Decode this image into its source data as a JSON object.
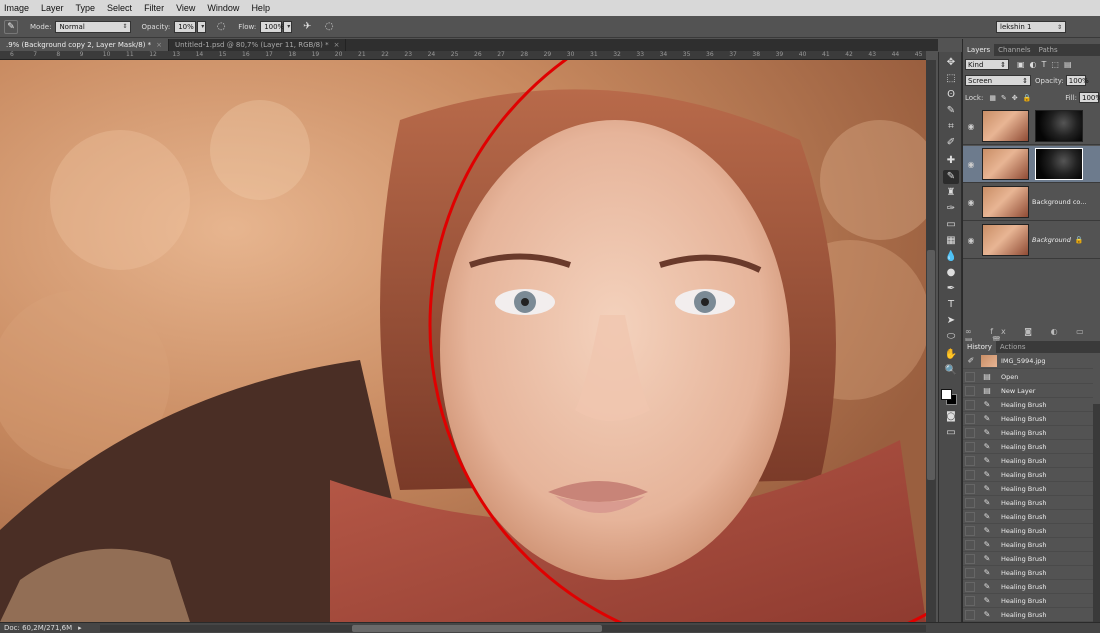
{
  "menu": [
    "Image",
    "Layer",
    "Type",
    "Select",
    "Filter",
    "View",
    "Window",
    "Help"
  ],
  "options": {
    "mode_label": "Mode:",
    "mode_value": "Normal",
    "opacity_label": "Opacity:",
    "opacity_value": "10%",
    "flow_label": "Flow:",
    "flow_value": "100%",
    "workspace": "lekshin 1"
  },
  "tabs": [
    {
      "label": ".9% (Background copy 2, Layer Mask/8) *",
      "active": true
    },
    {
      "label": "Untitled-1.psd @ 80,7% (Layer 11, RGB/8) *",
      "active": false
    }
  ],
  "ruler_ticks": [
    "6",
    "7",
    "8",
    "9",
    "10",
    "11",
    "12",
    "13",
    "14",
    "15",
    "16",
    "17",
    "18",
    "19",
    "20",
    "21",
    "22",
    "23",
    "24",
    "25",
    "26",
    "27",
    "28",
    "29",
    "30",
    "31",
    "32",
    "33",
    "34",
    "35",
    "36",
    "37",
    "38",
    "39",
    "40",
    "41",
    "42",
    "43",
    "44",
    "45"
  ],
  "status": {
    "doc": "Doc: 60,2M/271,6M"
  },
  "layers_panel": {
    "tabs": [
      "Layers",
      "Channels",
      "Paths"
    ],
    "kind": "Kind",
    "blend_mode": "Screen",
    "opacity_label": "Opacity:",
    "opacity_value": "100%",
    "lock_label": "Lock:",
    "fill_label": "Fill:",
    "fill_value": "100%",
    "layers": [
      {
        "name": "",
        "has_mask": true,
        "selected": false
      },
      {
        "name": "",
        "has_mask": true,
        "selected": true
      },
      {
        "name": "Background co...",
        "has_mask": false,
        "selected": false
      },
      {
        "name": "Background",
        "has_mask": false,
        "selected": false
      }
    ]
  },
  "history_panel": {
    "tabs": [
      "History",
      "Actions"
    ],
    "snapshot": "IMG_5994.jpg",
    "items": [
      "Open",
      "New Layer",
      "Healing Brush",
      "Healing Brush",
      "Healing Brush",
      "Healing Brush",
      "Healing Brush",
      "Healing Brush",
      "Healing Brush",
      "Healing Brush",
      "Healing Brush",
      "Healing Brush",
      "Healing Brush",
      "Healing Brush",
      "Healing Brush",
      "Healing Brush",
      "Healing Brush",
      "Healing Brush"
    ]
  },
  "colors": {
    "annotation_circle": "#e00000",
    "ui_dark": "#535353",
    "selected_layer": "#6d7b8d"
  },
  "tool_icons": [
    "move-tool-icon",
    "marquee-tool-icon",
    "lasso-tool-icon",
    "quick-selection-tool-icon",
    "crop-tool-icon",
    "eyedropper-tool-icon",
    "spot-healing-tool-icon",
    "brush-tool-icon",
    "clone-stamp-tool-icon",
    "history-brush-tool-icon",
    "eraser-tool-icon",
    "gradient-tool-icon",
    "blur-tool-icon",
    "dodge-tool-icon",
    "pen-tool-icon",
    "type-tool-icon",
    "path-selection-tool-icon",
    "shape-tool-icon",
    "hand-tool-icon",
    "zoom-tool-icon"
  ]
}
